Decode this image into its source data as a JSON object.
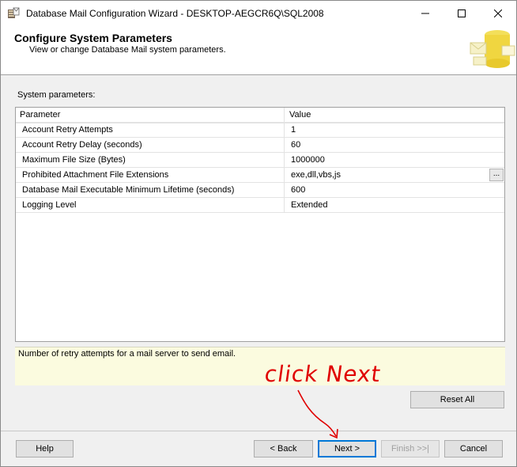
{
  "window": {
    "title": "Database Mail Configuration Wizard - DESKTOP-AEGCR6Q\\SQL2008"
  },
  "header": {
    "title": "Configure System Parameters",
    "subtitle": "View or change Database Mail system parameters."
  },
  "section_label": "System parameters:",
  "grid": {
    "columns": {
      "parameter": "Parameter",
      "value": "Value"
    },
    "rows": [
      {
        "parameter": "Account Retry Attempts",
        "value": "1"
      },
      {
        "parameter": "Account Retry Delay (seconds)",
        "value": "60"
      },
      {
        "parameter": "Maximum File Size (Bytes)",
        "value": "1000000"
      },
      {
        "parameter": "Prohibited Attachment File Extensions",
        "value": "exe,dll,vbs,js",
        "ellipsis": "..."
      },
      {
        "parameter": "Database Mail Executable Minimum Lifetime (seconds)",
        "value": "600"
      },
      {
        "parameter": "Logging Level",
        "value": "Extended"
      }
    ]
  },
  "description": "Number of retry attempts for a mail server to send email.",
  "buttons": {
    "reset_all": "Reset All",
    "help": "Help",
    "back": "< Back",
    "next": "Next >",
    "finish": "Finish >>|",
    "cancel": "Cancel"
  },
  "annotation": "click Next",
  "colors": {
    "accent": "#0078d7",
    "annotation": "#e00000",
    "description_bg": "#fbfbdf"
  }
}
